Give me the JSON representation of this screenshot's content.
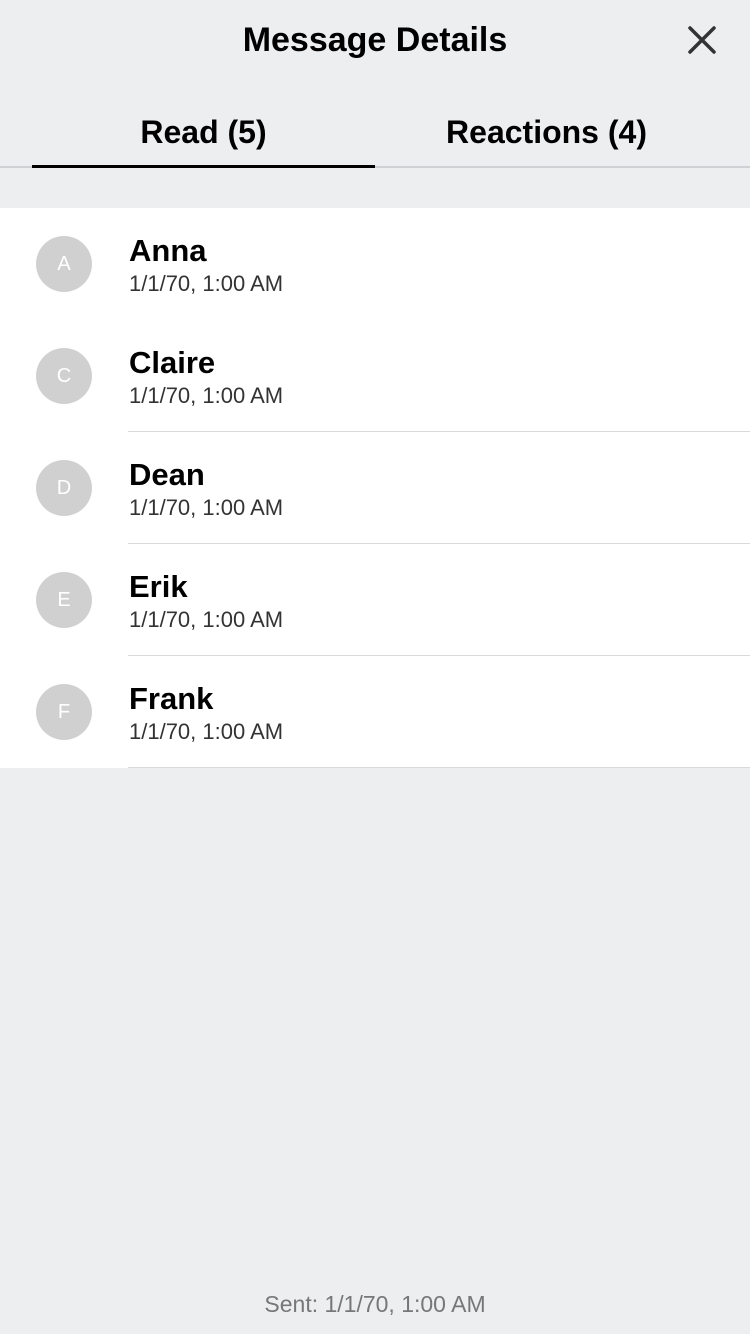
{
  "header": {
    "title": "Message Details",
    "close_icon": "close-icon"
  },
  "tabs": [
    {
      "label": "Read (5)",
      "selected": true
    },
    {
      "label": "Reactions (4)",
      "selected": false
    }
  ],
  "readers": [
    {
      "initial": "A",
      "name": "Anna",
      "time": "1/1/70, 1:00 AM"
    },
    {
      "initial": "C",
      "name": "Claire",
      "time": "1/1/70, 1:00 AM"
    },
    {
      "initial": "D",
      "name": "Dean",
      "time": "1/1/70, 1:00 AM"
    },
    {
      "initial": "E",
      "name": "Erik",
      "time": "1/1/70, 1:00 AM"
    },
    {
      "initial": "F",
      "name": "Frank",
      "time": "1/1/70, 1:00 AM"
    }
  ],
  "footer": {
    "sent": "Sent: 1/1/70, 1:00 AM"
  },
  "colors": {
    "background": "#EDEEF0",
    "list_background": "#FFFFFF",
    "avatar": "#D0D0D0",
    "selected_tab_underline": "#000000"
  }
}
